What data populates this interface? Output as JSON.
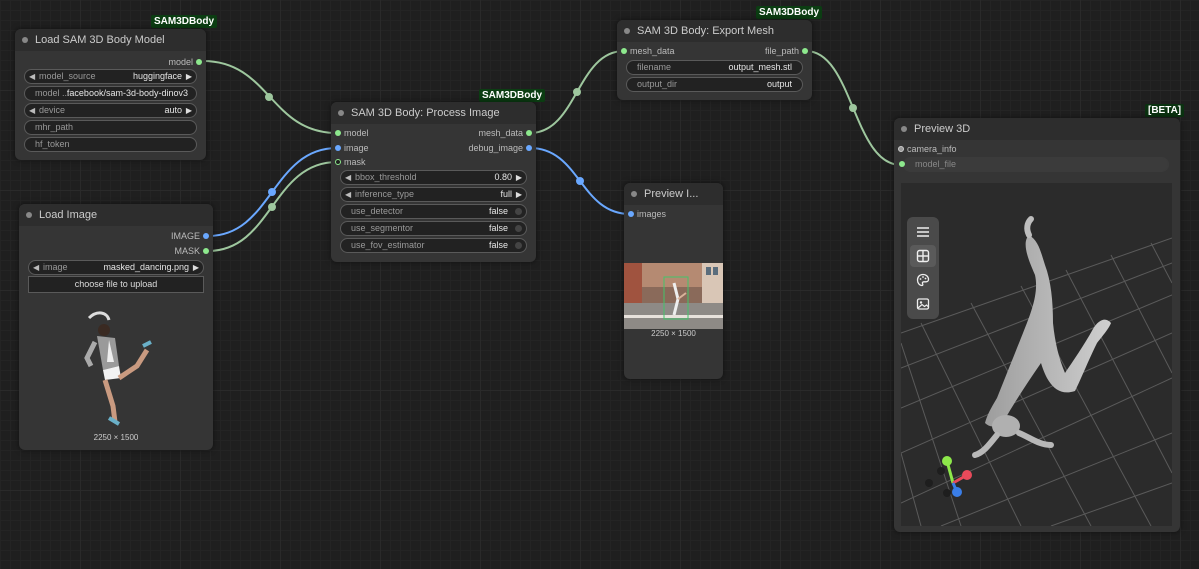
{
  "badges": {
    "load_model": "SAM3DBody",
    "process": "SAM3DBody",
    "export": "SAM3DBody",
    "preview3d": "[BETA]"
  },
  "load_model_node": {
    "title": "Load SAM 3D Body Model",
    "output": "model",
    "widgets": [
      {
        "label": "model_source",
        "value": "huggingface"
      },
      {
        "label": "model ...",
        "value": "facebook/sam-3d-body-dinov3"
      },
      {
        "label": "device",
        "value": "auto"
      },
      {
        "label": "mhr_path",
        "value": ""
      },
      {
        "label": "hf_token",
        "value": ""
      }
    ]
  },
  "load_image_node": {
    "title": "Load Image",
    "outputs": [
      "IMAGE",
      "MASK"
    ],
    "image_widget": {
      "label": "image",
      "value": "masked_dancing.png"
    },
    "upload_label": "choose file to upload",
    "caption": "2250 × 1500"
  },
  "process_node": {
    "title": "SAM 3D Body: Process Image",
    "inputs": [
      "model",
      "image",
      "mask"
    ],
    "outputs": [
      "mesh_data",
      "debug_image"
    ],
    "widgets": [
      {
        "label": "bbox_threshold",
        "value": "0.80"
      },
      {
        "label": "inference_type",
        "value": "full"
      },
      {
        "label": "use_detector",
        "value": "false"
      },
      {
        "label": "use_segmentor",
        "value": "false"
      },
      {
        "label": "use_fov_estimator",
        "value": "false"
      }
    ]
  },
  "export_node": {
    "title": "SAM 3D Body: Export Mesh",
    "input": "mesh_data",
    "output": "file_path",
    "widgets": [
      {
        "label": "filename",
        "value": "output_mesh.stl"
      },
      {
        "label": "output_dir",
        "value": "output"
      }
    ]
  },
  "preview_image_node": {
    "title": "Preview I...",
    "input": "images",
    "caption": "2250 × 1500"
  },
  "preview3d_node": {
    "title": "Preview 3D",
    "inputs": [
      "camera_info",
      "model_file"
    ],
    "toolbar": [
      "menu-icon",
      "grid-icon",
      "palette-icon",
      "image-icon"
    ]
  },
  "colors": {
    "link_green": "#9ec79e",
    "link_blue": "#6aa8ff",
    "badge_bg": "#0b3d12",
    "node_bg": "#353535"
  }
}
